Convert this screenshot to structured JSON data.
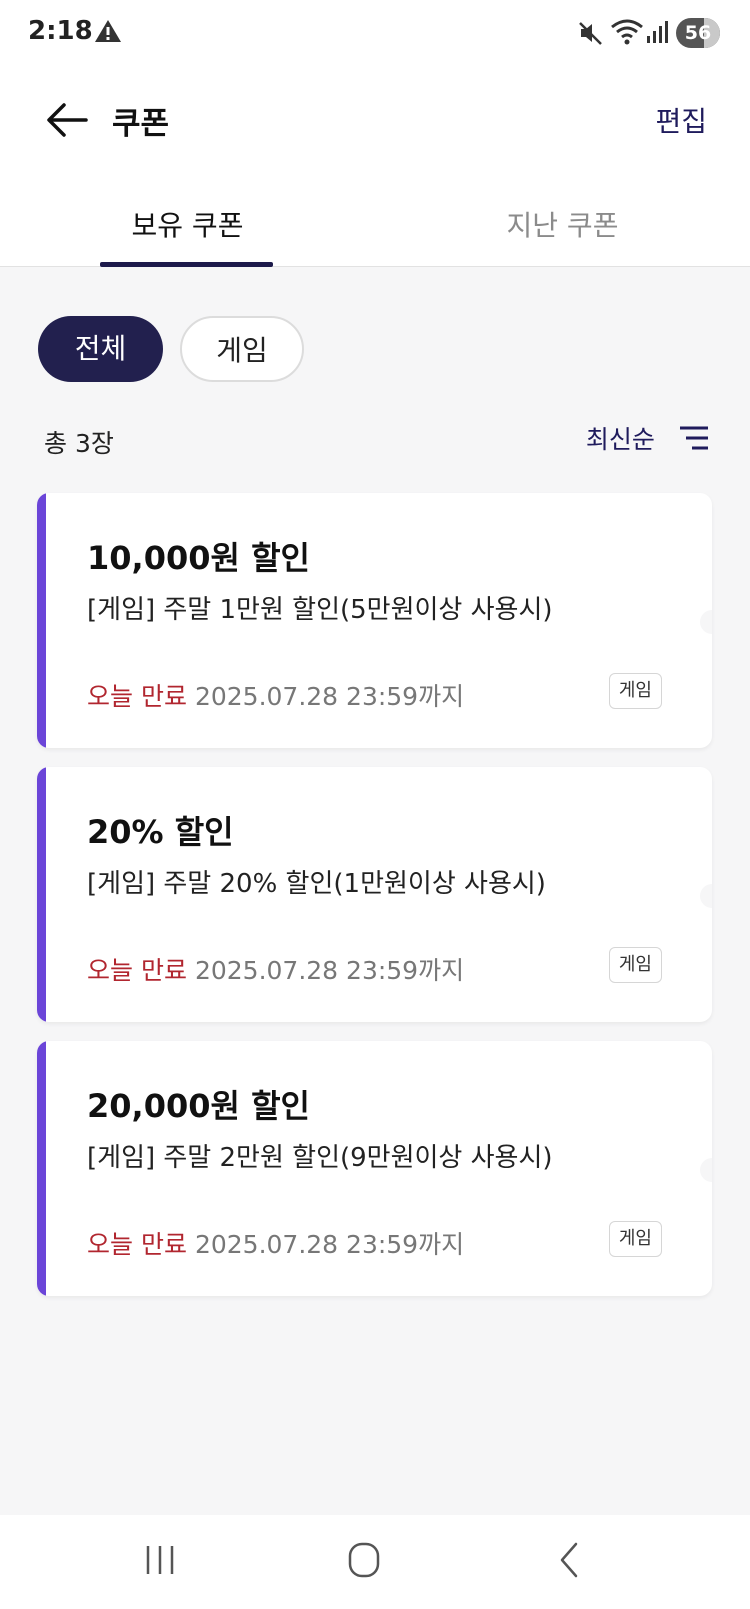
{
  "status_bar": {
    "time": "2:18",
    "battery_level": "56",
    "icons": [
      "warning-icon",
      "mute-icon",
      "wifi-icon",
      "signal-icon",
      "battery-icon"
    ]
  },
  "app_bar": {
    "title": "쿠폰",
    "edit_label": "편집"
  },
  "tabs": [
    {
      "label": "보유 쿠폰",
      "active": true
    },
    {
      "label": "지난 쿠폰",
      "active": false
    }
  ],
  "filters": [
    {
      "label": "전체",
      "selected": true
    },
    {
      "label": "게임",
      "selected": false
    }
  ],
  "list": {
    "count_text": "총 3장",
    "sort_label": "최신순"
  },
  "coupons": [
    {
      "amount": "10,000원 할인",
      "description": "[게임] 주말 1만원 할인(5만원이상 사용시)",
      "expiry_label": "오늘 만료",
      "expiry_date": "2025.07.28 23:59까지",
      "tag": "게임"
    },
    {
      "amount": "20% 할인",
      "description": "[게임] 주말 20% 할인(1만원이상 사용시)",
      "expiry_label": "오늘 만료",
      "expiry_date": "2025.07.28 23:59까지",
      "tag": "게임"
    },
    {
      "amount": "20,000원 할인",
      "description": "[게임] 주말 2만원 할인(9만원이상 사용시)",
      "expiry_label": "오늘 만료",
      "expiry_date": "2025.07.28 23:59까지",
      "tag": "게임"
    }
  ],
  "colors": {
    "accent_bar": "#6b45d8",
    "primary_dark": "#22204e",
    "expire_red": "#b1262f",
    "background": "#f6f6f7"
  },
  "nav_bar": {
    "icons": [
      "recent-apps-icon",
      "home-icon",
      "back-nav-icon"
    ]
  }
}
